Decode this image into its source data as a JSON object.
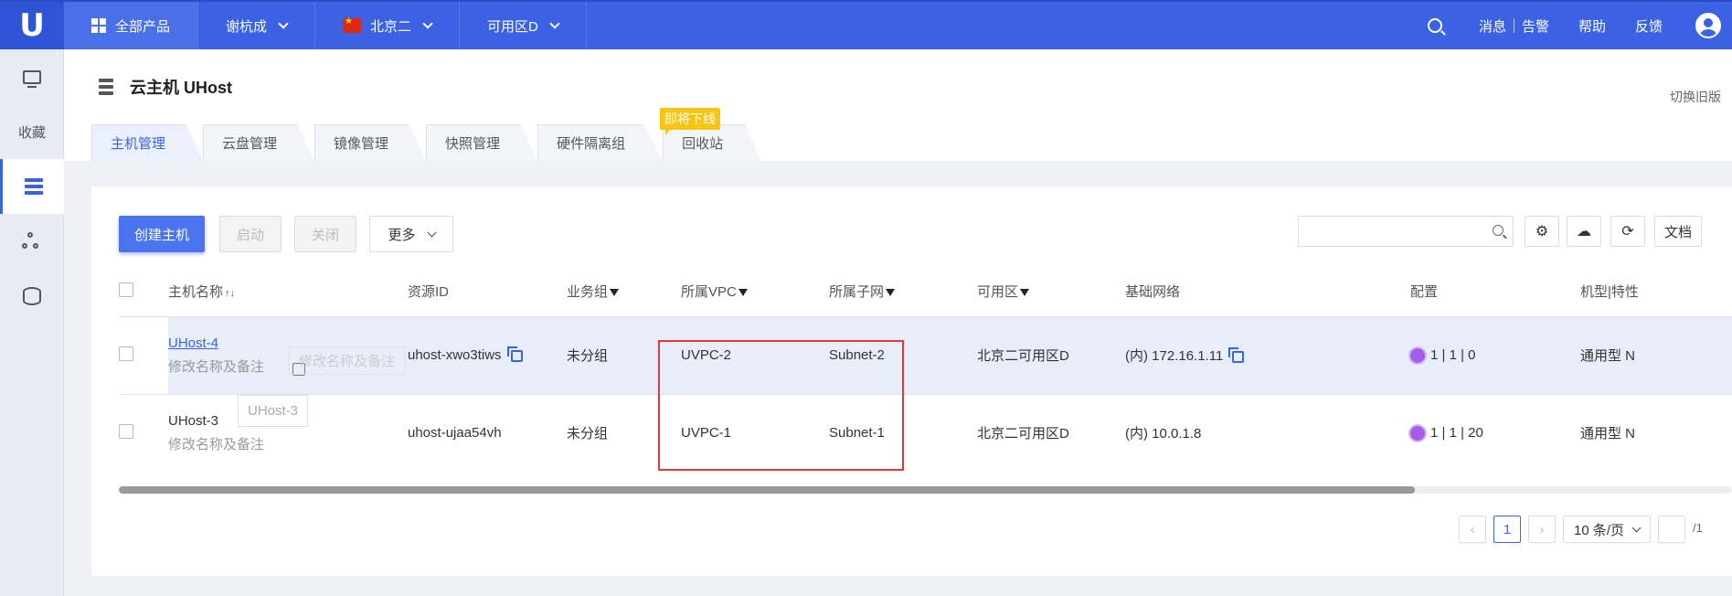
{
  "topbar": {
    "logo": "U",
    "all_products": "全部产品",
    "user": "谢杭成",
    "region": "北京二",
    "zone": "可用区D",
    "messages": "消息",
    "alerts": "告警",
    "help": "帮助",
    "feedback": "反馈"
  },
  "sidebar": {
    "favorites": "收藏"
  },
  "header": {
    "title": "云主机 UHost",
    "switch_old": "切换旧版",
    "tabs": [
      "主机管理",
      "云盘管理",
      "镜像管理",
      "快照管理",
      "硬件隔离组",
      "回收站"
    ],
    "soon_badge": "即将下线"
  },
  "toolbar": {
    "create": "创建主机",
    "start": "启动",
    "stop": "关闭",
    "more": "更多",
    "docs": "文档",
    "search_placeholder": ""
  },
  "table": {
    "headers": [
      "主机名称",
      "资源ID",
      "业务组",
      "所属VPC",
      "所属子网",
      "可用区",
      "基础网络",
      "配置",
      "机型|特性"
    ],
    "rows": [
      {
        "name": "UHost-4",
        "remark": "修改名称及备注",
        "edit_hint": "修改名称及备注",
        "id": "uhost-xwo3tiws",
        "group": "未分组",
        "vpc": "UVPC-2",
        "subnet": "Subnet-2",
        "zone": "北京二可用区D",
        "network": "(内) 172.16.1.11",
        "config": "1 | 1 | 0",
        "type": "通用型 N"
      },
      {
        "name": "UHost-3",
        "remark": "修改名称及备注",
        "tooltip": "UHost-3",
        "id": "uhost-ujaa54vh",
        "group": "未分组",
        "vpc": "UVPC-1",
        "subnet": "Subnet-1",
        "zone": "北京二可用区D",
        "network": "(内) 10.0.1.8",
        "config": "1 | 1 | 20",
        "type": "通用型 N"
      }
    ]
  },
  "pagination": {
    "current": "1",
    "page_size": "10 条/页",
    "total": "/1"
  },
  "colors": {
    "primary": "#3b62e3",
    "highlight_box": "#e03a3a",
    "badge": "#f5c518"
  }
}
